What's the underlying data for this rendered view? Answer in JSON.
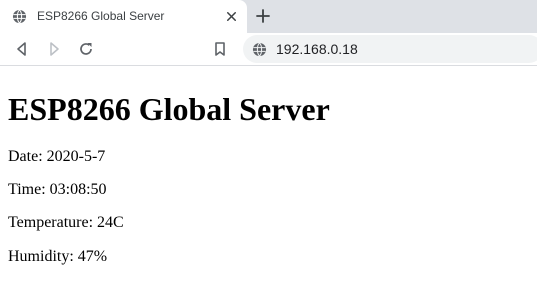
{
  "browser": {
    "tab": {
      "title": "ESP8266 Global Server"
    },
    "address_bar": {
      "url": "192.168.0.18"
    },
    "icons": {
      "favicon": "globe-icon",
      "tab_close": "close-icon",
      "new_tab": "plus-icon",
      "back": "back-arrow-icon",
      "forward": "forward-arrow-icon",
      "reload": "reload-icon",
      "bookmark": "bookmark-icon",
      "site_info": "globe-icon"
    },
    "colors": {
      "tabstrip": "#dee1e6",
      "omnibox": "#f1f3f4",
      "icon": "#5f6368"
    }
  },
  "page": {
    "heading": "ESP8266 Global Server",
    "lines": [
      "Date: 2020-5-7",
      "Time: 03:08:50",
      "Temperature: 24C",
      "Humidity: 47%"
    ]
  }
}
